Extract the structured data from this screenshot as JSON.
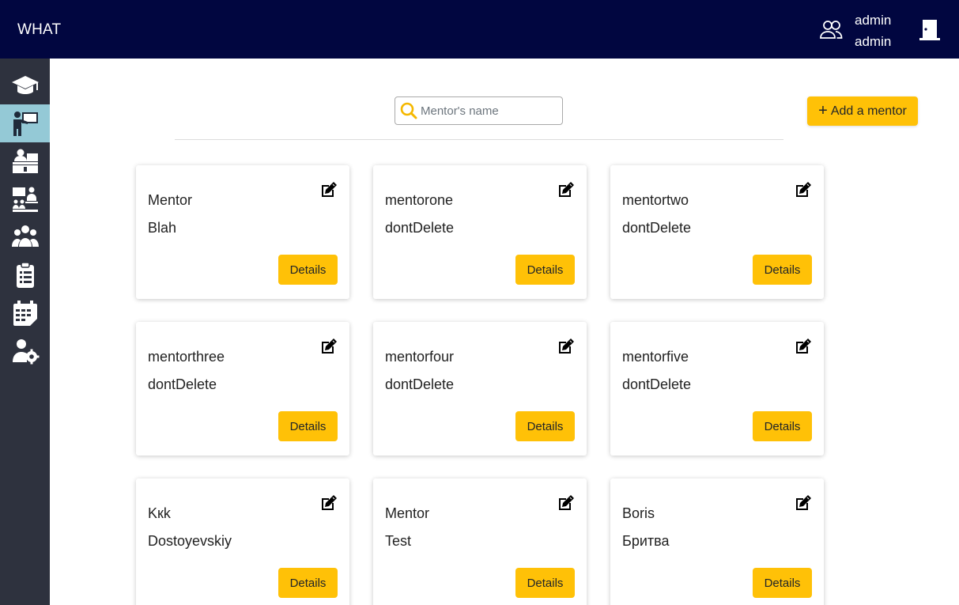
{
  "header": {
    "brand": "WHAT",
    "user_first": "admin",
    "user_last": "admin",
    "users_icon": "users-icon",
    "logout_icon": "door-exit-icon",
    "background": "#010640"
  },
  "sidebar": {
    "items": [
      {
        "icon": "graduation-cap-icon",
        "active": false
      },
      {
        "icon": "teacher-board-icon",
        "active": true
      },
      {
        "icon": "student-desk-icon",
        "active": false
      },
      {
        "icon": "classroom-icon",
        "active": false
      },
      {
        "icon": "group-icon",
        "active": false
      },
      {
        "icon": "clipboard-list-icon",
        "active": false
      },
      {
        "icon": "calendar-schedule-icon",
        "active": false
      },
      {
        "icon": "user-settings-icon",
        "active": false
      }
    ],
    "active_color": "#94c9d6"
  },
  "search": {
    "placeholder": "Mentor's name",
    "value": ""
  },
  "toolbar": {
    "add_label": "Add a mentor",
    "accent": "#ffc107"
  },
  "mentors": [
    {
      "first_name": "Mentor",
      "last_name": "Blah",
      "details_label": "Details"
    },
    {
      "first_name": "mentorone",
      "last_name": "dontDelete",
      "details_label": "Details"
    },
    {
      "first_name": "mentortwo",
      "last_name": "dontDelete",
      "details_label": "Details"
    },
    {
      "first_name": "mentorthree",
      "last_name": "dontDelete",
      "details_label": "Details"
    },
    {
      "first_name": "mentorfour",
      "last_name": "dontDelete",
      "details_label": "Details"
    },
    {
      "first_name": "mentorfive",
      "last_name": "dontDelete",
      "details_label": "Details"
    },
    {
      "first_name": "Kкk",
      "last_name": "Dostoyevskiy",
      "details_label": "Details"
    },
    {
      "first_name": "Mentor",
      "last_name": "Test",
      "details_label": "Details"
    },
    {
      "first_name": "Boris",
      "last_name": "Бритва",
      "details_label": "Details"
    }
  ]
}
